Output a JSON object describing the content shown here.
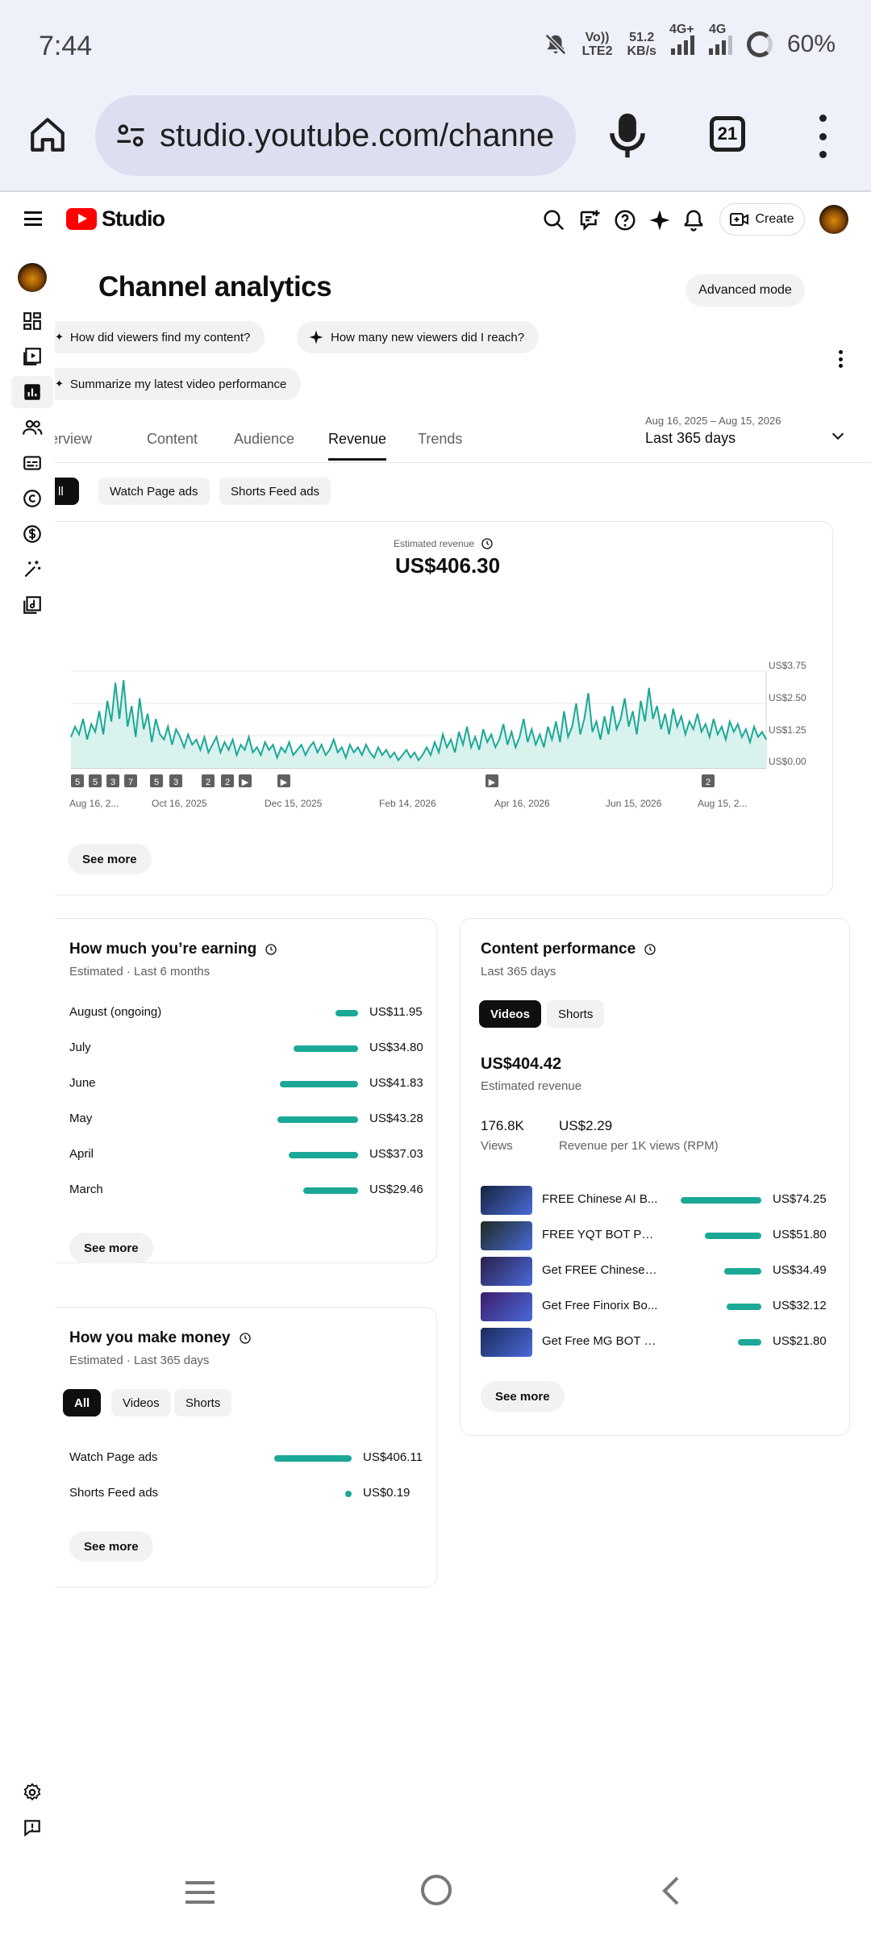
{
  "status_bar": {
    "time": "7:44",
    "volte_line1": "Vo))",
    "volte_line2": "LTE2",
    "speed_line1": "51.2",
    "speed_line2": "KB/s",
    "network1": "4G+",
    "network2": "4G",
    "battery": "60%"
  },
  "browser": {
    "url": "studio.youtube.com/channe",
    "tab_count": "21"
  },
  "header": {
    "logo_text": "Studio",
    "create_label": "Create"
  },
  "page": {
    "title": "Channel analytics",
    "advanced_mode": "Advanced mode",
    "suggestions": [
      "How did viewers find my content?",
      "How many new viewers did I reach?",
      "Summarize my latest video performance"
    ]
  },
  "tabs": [
    "Overview",
    "Content",
    "Audience",
    "Revenue",
    "Trends"
  ],
  "tab_labels_visible": [
    "erview",
    "Content",
    "Audience",
    "Revenue",
    "Trends"
  ],
  "active_tab": "Revenue",
  "date_range": {
    "range": "Aug 16, 2025 – Aug 15, 2026",
    "label": "Last 365 days"
  },
  "revenue_filters": [
    "ll",
    "Watch Page ads",
    "Shorts Feed ads"
  ],
  "revenue_card": {
    "label": "Estimated revenue",
    "value": "US$406.30",
    "see_more": "See more",
    "x_ticks": [
      "Aug 16, 2...",
      "Oct 16, 2025",
      "Dec 15, 2025",
      "Feb 14, 2026",
      "Apr 16, 2026",
      "Jun 15, 2026",
      "Aug 15, 2..."
    ],
    "y_ticks": [
      "US$3.75",
      "US$2.50",
      "US$1.25",
      "US$0.00"
    ],
    "markers": [
      "5",
      "5",
      "3",
      "7",
      "5",
      "3",
      "2",
      "2",
      "2"
    ]
  },
  "chart_data": {
    "type": "area",
    "title": "Estimated revenue",
    "x_ticks": [
      "Aug 16, 2...",
      "Oct 16, 2025",
      "Dec 15, 2025",
      "Feb 14, 2026",
      "Apr 16, 2026",
      "Jun 15, 2026",
      "Aug 15, 2..."
    ],
    "ylim": [
      0,
      3.75
    ],
    "y_ticks": [
      0,
      1.25,
      2.5,
      3.75
    ],
    "series": [
      {
        "values": [
          1.2,
          1.6,
          1.3,
          1.9,
          1.1,
          1.7,
          1.4,
          2.2,
          1.3,
          2.6,
          1.8,
          3.3,
          1.9,
          3.4,
          1.6,
          2.4,
          1.2,
          2.7,
          1.5,
          2.1,
          1.0,
          1.9,
          1.3,
          1.1,
          1.6,
          0.9,
          1.5,
          1.2,
          0.8,
          1.3,
          0.9,
          1.1,
          0.7,
          1.2,
          0.6,
          0.9,
          1.2,
          0.6,
          1.0,
          0.7,
          1.1,
          0.5,
          0.9,
          0.7,
          1.2,
          0.6,
          0.8,
          0.5,
          1.0,
          0.7,
          0.9,
          0.4,
          0.8,
          0.6,
          1.0,
          0.5,
          0.7,
          0.9,
          0.5,
          0.8,
          1.0,
          0.6,
          0.9,
          0.5,
          0.7,
          1.1,
          0.6,
          0.8,
          0.4,
          0.9,
          0.6,
          0.8,
          0.5,
          0.9,
          0.6,
          0.4,
          0.8,
          0.5,
          0.7,
          0.4,
          0.6,
          0.3,
          0.5,
          0.7,
          0.4,
          0.6,
          0.3,
          0.5,
          0.8,
          0.5,
          1.0,
          0.6,
          1.3,
          0.8,
          1.1,
          0.6,
          1.4,
          0.9,
          1.6,
          0.8,
          1.2,
          0.7,
          1.5,
          1.0,
          1.3,
          0.8,
          1.1,
          1.7,
          0.9,
          1.4,
          0.8,
          1.2,
          1.9,
          1.0,
          1.5,
          0.9,
          1.3,
          0.8,
          1.6,
          1.1,
          1.8,
          1.0,
          2.2,
          1.2,
          1.6,
          2.5,
          1.3,
          1.9,
          2.9,
          1.4,
          1.8,
          1.1,
          2.0,
          1.3,
          2.4,
          1.5,
          1.9,
          2.7,
          1.6,
          2.2,
          1.3,
          2.6,
          1.8,
          3.1,
          1.9,
          2.4,
          1.5,
          2.1,
          1.3,
          2.3,
          1.6,
          2.0,
          1.3,
          1.8,
          1.5,
          2.1,
          1.4,
          1.7,
          1.2,
          1.9,
          1.3,
          1.6,
          1.1,
          1.8,
          1.4,
          1.7,
          1.2,
          1.5,
          1.0,
          1.6,
          1.2,
          1.4,
          1.1
        ]
      }
    ]
  },
  "earning_card": {
    "title": "How much you’re earning",
    "subtitle": "Estimated · Last 6 months",
    "rows": [
      {
        "label": "August (ongoing)",
        "value": "US$11.95",
        "amount": 11.95
      },
      {
        "label": "July",
        "value": "US$34.80",
        "amount": 34.8
      },
      {
        "label": "June",
        "value": "US$41.83",
        "amount": 41.83
      },
      {
        "label": "May",
        "value": "US$43.28",
        "amount": 43.28
      },
      {
        "label": "April",
        "value": "US$37.03",
        "amount": 37.03
      },
      {
        "label": "March",
        "value": "US$29.46",
        "amount": 29.46
      }
    ],
    "see_more": "See more"
  },
  "money_card": {
    "title": "How you make money",
    "subtitle": "Estimated · Last 365 days",
    "chips": [
      "All",
      "Videos",
      "Shorts"
    ],
    "rows": [
      {
        "label": "Watch Page ads",
        "value": "US$406.11",
        "amount": 406.11
      },
      {
        "label": "Shorts Feed ads",
        "value": "US$0.19",
        "amount": 0.19
      }
    ],
    "see_more": "See more"
  },
  "content_card": {
    "title": "Content performance",
    "subtitle": "Last 365 days",
    "chips": [
      "Videos",
      "Shorts"
    ],
    "revenue": "US$404.42",
    "revenue_label": "Estimated revenue",
    "views": "176.8K",
    "views_label": "Views",
    "rpm": "US$2.29",
    "rpm_label": "Revenue per 1K views (RPM)",
    "videos": [
      {
        "title": "FREE Chinese AI B...",
        "value": "US$74.25",
        "amount": 74.25,
        "color": "#16243f"
      },
      {
        "title": "FREE YQT BOT PR...",
        "value": "US$51.80",
        "amount": 51.8,
        "color": "#1d2b22"
      },
      {
        "title": "Get FREE Chinese ...",
        "value": "US$34.49",
        "amount": 34.49,
        "color": "#2a1f4a"
      },
      {
        "title": "Get Free Finorix Bo...",
        "value": "US$32.12",
        "amount": 32.12,
        "color": "#3b1d6b"
      },
      {
        "title": "Get Free MG BOT P...",
        "value": "US$21.80",
        "amount": 21.8,
        "color": "#1b2a5a"
      }
    ],
    "see_more": "See more"
  }
}
